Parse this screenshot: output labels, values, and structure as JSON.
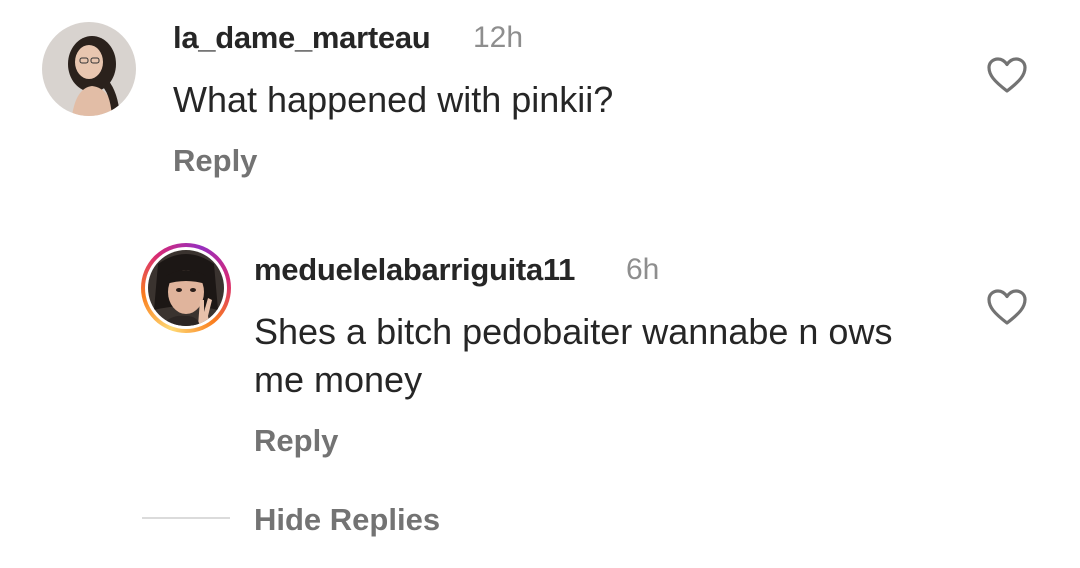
{
  "comments": [
    {
      "username": "la_dame_marteau",
      "time": "12h",
      "text": "What happened with pinkii?",
      "reply_label": "Reply",
      "avatar": "user-photo"
    },
    {
      "username": "meduelelabarriguita11",
      "time": "6h",
      "text": "Shes a bitch pedobaiter wannabe n ows me money",
      "reply_label": "Reply",
      "avatar": "user-photo-story-ring"
    }
  ],
  "hide_replies_label": "Hide Replies",
  "icons": {
    "like": "heart-outline-icon"
  },
  "colors": {
    "text": "#262626",
    "muted": "#737373",
    "time": "#8e8e8e",
    "divider": "#dbdbdb"
  }
}
